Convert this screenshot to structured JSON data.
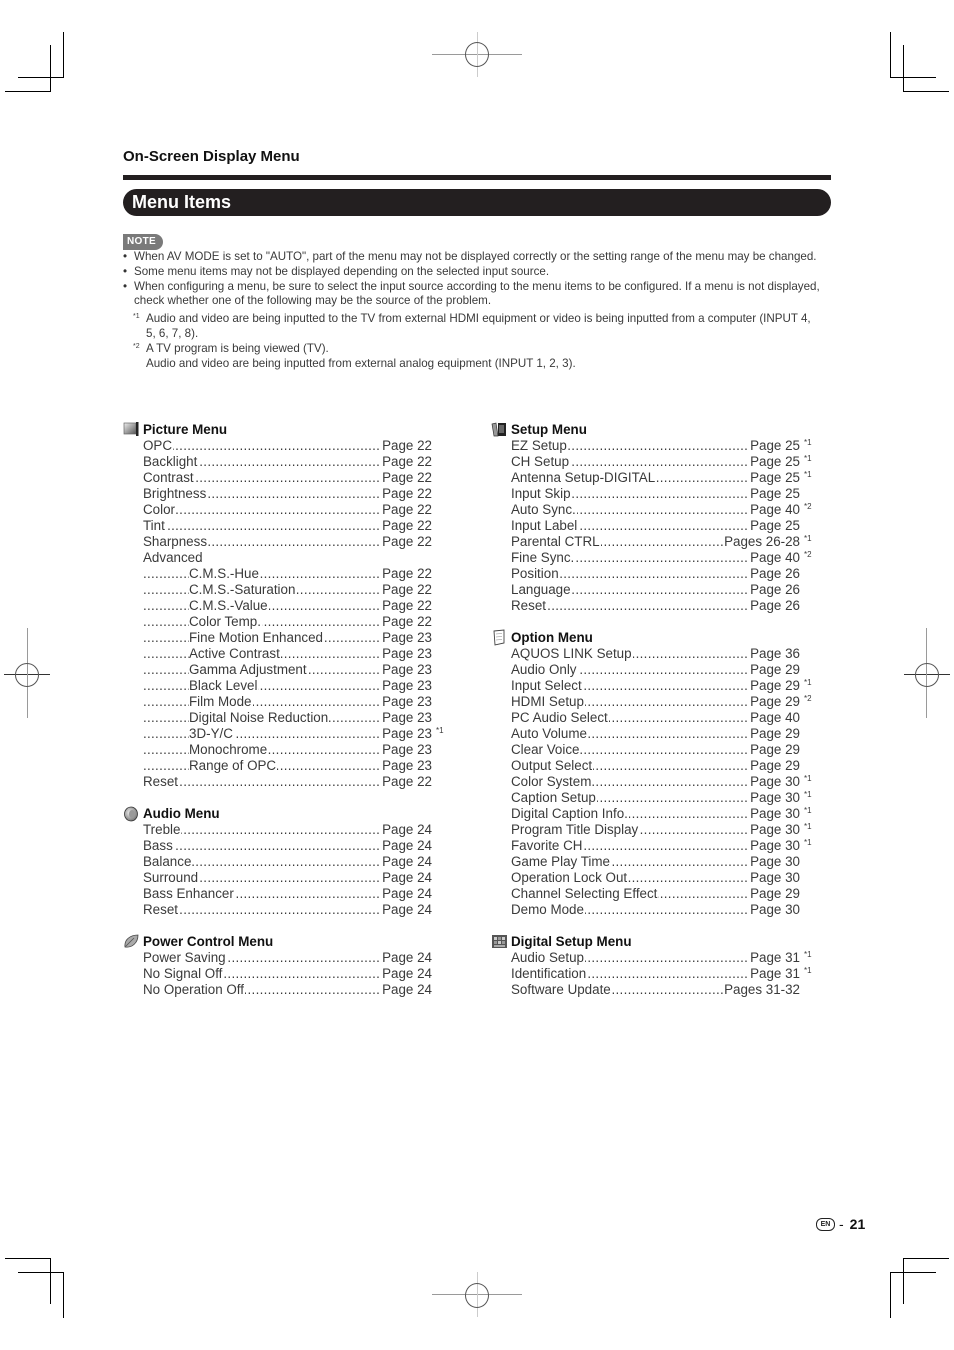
{
  "header": {
    "section": "On-Screen Display Menu",
    "title": "Menu Items"
  },
  "note": {
    "badge": "NOTE",
    "bullets": [
      "When AV MODE is set to \"AUTO\", part of the menu may not be displayed correctly or the setting range of the menu may be changed.",
      "Some menu items may not be displayed depending on the selected input source.",
      "When configuring a menu, be sure to select the input source according to the menu items to be configured. If a menu is not displayed, check whether one of the following may be the source of the problem."
    ],
    "footnotes": [
      {
        "mark": "*1",
        "text": "Audio and video are being inputted to the TV from external HDMI equipment or video is being inputted from a computer (INPUT 4, 5, 6, 7, 8)."
      },
      {
        "mark": "*2",
        "text": "A TV program is being viewed (TV).",
        "text2": "Audio and video are being inputted from external analog equipment (INPUT 1, 2, 3)."
      }
    ]
  },
  "left_menus": [
    {
      "title": "Picture Menu",
      "icon": "picture-menu-icon",
      "items": [
        {
          "label": "OPC",
          "page": "Page 22"
        },
        {
          "label": "Backlight",
          "page": "Page 22"
        },
        {
          "label": "Contrast",
          "page": "Page 22"
        },
        {
          "label": "Brightness",
          "page": "Page 22"
        },
        {
          "label": "Color",
          "page": "Page 22"
        },
        {
          "label": "Tint",
          "page": "Page 22"
        },
        {
          "label": "Sharpness",
          "page": "Page 22"
        },
        {
          "label": "Advanced",
          "page": ""
        },
        {
          "label": "C.M.S.-Hue",
          "page": "Page 22",
          "indent": true
        },
        {
          "label": "C.M.S.-Saturation",
          "page": "Page 22",
          "indent": true
        },
        {
          "label": "C.M.S.-Value",
          "page": "Page 22",
          "indent": true
        },
        {
          "label": "Color Temp.",
          "page": "Page 22",
          "indent": true
        },
        {
          "label": "Fine Motion Enhanced",
          "page": "Page 23",
          "indent": true
        },
        {
          "label": "Active Contrast",
          "page": "Page 23",
          "indent": true
        },
        {
          "label": "Gamma Adjustment",
          "page": "Page 23",
          "indent": true
        },
        {
          "label": "Black Level",
          "page": "Page 23",
          "indent": true
        },
        {
          "label": "Film Mode",
          "page": "Page 23",
          "indent": true
        },
        {
          "label": "Digital Noise Reduction",
          "page": "Page 23",
          "indent": true
        },
        {
          "label": "3D-Y/C",
          "page": "Page 23",
          "indent": true,
          "mark": "*1"
        },
        {
          "label": "Monochrome",
          "page": "Page 23",
          "indent": true
        },
        {
          "label": "Range of OPC",
          "page": "Page 23",
          "indent": true
        },
        {
          "label": "Reset",
          "page": "Page 22"
        }
      ]
    },
    {
      "title": "Audio Menu",
      "icon": "audio-menu-icon",
      "items": [
        {
          "label": "Treble",
          "page": "Page 24"
        },
        {
          "label": "Bass",
          "page": "Page 24"
        },
        {
          "label": "Balance",
          "page": "Page 24"
        },
        {
          "label": "Surround",
          "page": "Page 24"
        },
        {
          "label": "Bass Enhancer",
          "page": "Page 24"
        },
        {
          "label": "Reset",
          "page": "Page 24"
        }
      ]
    },
    {
      "title": "Power Control Menu",
      "icon": "power-control-menu-icon",
      "items": [
        {
          "label": "Power Saving",
          "page": "Page 24"
        },
        {
          "label": "No Signal Off",
          "page": "Page 24"
        },
        {
          "label": "No Operation Off",
          "page": "Page 24"
        }
      ]
    }
  ],
  "right_menus": [
    {
      "title": "Setup Menu",
      "icon": "setup-menu-icon",
      "items": [
        {
          "label": "EZ Setup",
          "page": "Page 25",
          "mark": "*1"
        },
        {
          "label": "CH Setup",
          "page": "Page 25",
          "mark": "*1"
        },
        {
          "label": "Antenna Setup-DIGITAL",
          "page": "Page 25",
          "mark": "*1"
        },
        {
          "label": "Input Skip",
          "page": "Page 25"
        },
        {
          "label": "Auto Sync.",
          "page": "Page 40",
          "mark": "*2"
        },
        {
          "label": "Input Label",
          "page": "Page 25"
        },
        {
          "label": "Parental CTRL",
          "page": "Pages 26-28",
          "mark": "*1"
        },
        {
          "label": "Fine Sync.",
          "page": "Page 40",
          "mark": "*2"
        },
        {
          "label": "Position",
          "page": "Page 26"
        },
        {
          "label": "Language",
          "page": "Page 26"
        },
        {
          "label": "Reset",
          "page": "Page 26"
        }
      ]
    },
    {
      "title": "Option Menu",
      "icon": "option-menu-icon",
      "items": [
        {
          "label": "AQUOS LINK Setup",
          "page": "Page 36"
        },
        {
          "label": "Audio Only",
          "page": "Page 29"
        },
        {
          "label": "Input Select",
          "page": "Page 29",
          "mark": "*1"
        },
        {
          "label": "HDMI Setup",
          "page": "Page 29",
          "mark": "*2"
        },
        {
          "label": "PC Audio Select",
          "page": "Page 40"
        },
        {
          "label": "Auto Volume",
          "page": "Page 29"
        },
        {
          "label": "Clear Voice",
          "page": "Page 29"
        },
        {
          "label": "Output Select",
          "page": "Page 29"
        },
        {
          "label": "Color System",
          "page": "Page 30",
          "mark": "*1"
        },
        {
          "label": "Caption Setup",
          "page": "Page 30",
          "mark": "*1"
        },
        {
          "label": "Digital Caption Info.",
          "page": "Page 30",
          "mark": "*1"
        },
        {
          "label": "Program Title Display",
          "page": "Page 30",
          "mark": "*1"
        },
        {
          "label": "Favorite CH",
          "page": "Page 30",
          "mark": "*1"
        },
        {
          "label": "Game Play Time",
          "page": "Page 30"
        },
        {
          "label": "Operation Lock Out",
          "page": "Page 30"
        },
        {
          "label": "Channel Selecting Effect",
          "page": "Page 29"
        },
        {
          "label": "Demo Mode",
          "page": "Page 30"
        }
      ]
    },
    {
      "title": "Digital Setup Menu",
      "icon": "digital-setup-menu-icon",
      "items": [
        {
          "label": "Audio Setup",
          "page": "Page 31",
          "mark": "*1"
        },
        {
          "label": "Identification",
          "page": "Page 31",
          "mark": "*1"
        },
        {
          "label": "Software Update",
          "page": "Pages 31-32"
        }
      ]
    }
  ],
  "footer": {
    "lang_badge": "EN",
    "separator": "-",
    "page_number": "21"
  }
}
